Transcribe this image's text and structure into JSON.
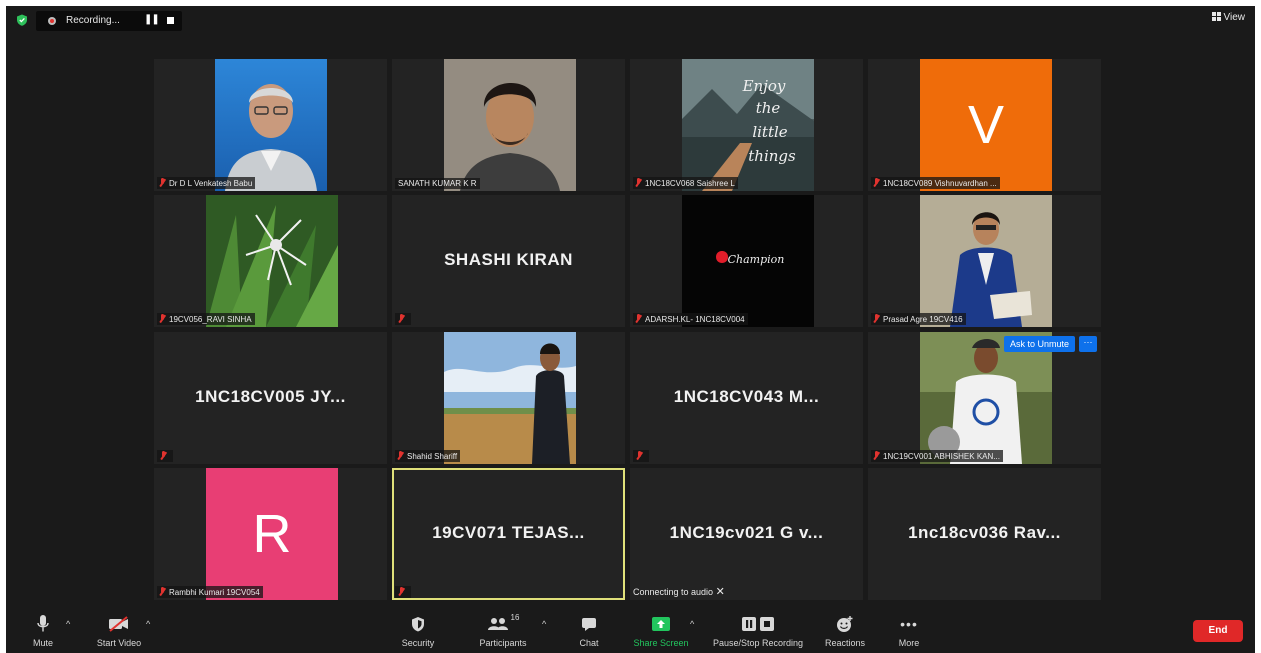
{
  "topbar": {
    "recording_text": "Recording...",
    "pause_glyph": "❚❚",
    "view_label": "View"
  },
  "tiles": [
    {
      "name_label": "Dr D L Venkatesh Babu",
      "muted": true
    },
    {
      "name_label": "SANATH KUMAR K R",
      "muted": false
    },
    {
      "name_label": "1NC18CV068 Saishree L",
      "muted": true,
      "photo_text": "Enjoy the little things"
    },
    {
      "name_label": "1NC18CV089 Vishnuvardhan ...",
      "muted": true,
      "avatar_letter": "V",
      "avatar_color": "#ef6c0a"
    },
    {
      "name_label": "19CV056_RAVI SINHA",
      "muted": true
    },
    {
      "big_name": "SHASHI KIRAN",
      "muted": true
    },
    {
      "name_label": "ADARSH.KL- 1NC18CV004",
      "muted": true,
      "photo_text": "Champion"
    },
    {
      "name_label": "Prasad Agre 19CV416",
      "muted": true
    },
    {
      "big_name": "1NC18CV005  JY...",
      "muted": true
    },
    {
      "name_label": "Shahid Shariff",
      "muted": true
    },
    {
      "big_name": "1NC18CV043  M...",
      "muted": true
    },
    {
      "name_label": "1NC19CV001 ABHISHEK KAN...",
      "muted": true,
      "ask_unmute": "Ask to Unmute",
      "more": "···"
    },
    {
      "name_label": "Rambhi Kumari 19CV054",
      "muted": true,
      "avatar_letter": "R",
      "avatar_color": "#e83e74"
    },
    {
      "big_name": "19CV071  TEJAS...",
      "muted": true,
      "speaking": true
    },
    {
      "big_name": "1NC19cv021  G  v...",
      "status": "Connecting to audio"
    },
    {
      "big_name": "1nc18cv036  Rav..."
    }
  ],
  "toolbar": {
    "mute": "Mute",
    "start_video": "Start Video",
    "security": "Security",
    "participants": "Participants",
    "participants_count": "16",
    "chat": "Chat",
    "share_screen": "Share Screen",
    "pause_stop_recording": "Pause/Stop Recording",
    "reactions": "Reactions",
    "more": "More",
    "end": "End"
  },
  "colors": {
    "share_green": "#22c55e",
    "end_red": "#e02828",
    "speaker_border": "#dfe07a",
    "accent_blue": "#0e71eb"
  }
}
